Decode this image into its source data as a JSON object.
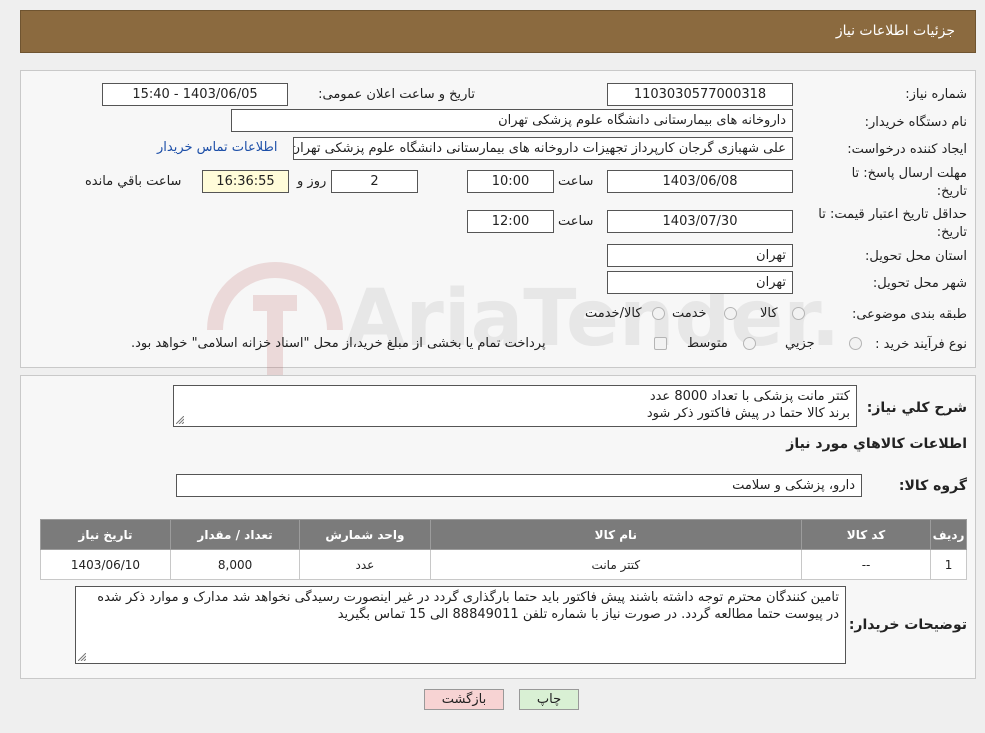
{
  "header": {
    "title": "جزئیات اطلاعات نیاز"
  },
  "form": {
    "need_number_label": "شماره نیاز:",
    "need_number": "1103030577000318",
    "announce_label": "تاریخ و ساعت اعلان عمومی:",
    "announce_value": "1403/06/05 - 15:40",
    "buyer_org_label": "نام دستگاه خریدار:",
    "buyer_org": "داروخانه های بیمارستانی دانشگاه علوم پزشکی تهران",
    "creator_label": "ایجاد کننده درخواست:",
    "creator": "علی شهبازی گرجان کارپرداز تجهیزات داروخانه های بیمارستانی دانشگاه علوم پزشکی تهران",
    "contact_link": "اطلاعات تماس خریدار",
    "reply_deadline_label_1": "مهلت ارسال پاسخ: تا",
    "reply_deadline_label_2": "تاریخ:",
    "reply_date": "1403/06/08",
    "time_label": "ساعت",
    "reply_time": "10:00",
    "days_value": "2",
    "days_label": "روز و",
    "remaining_time": "16:36:55",
    "remaining_label": "ساعت باقي مانده",
    "price_validity_label_1": "حداقل تاریخ اعتبار قیمت: تا",
    "price_validity_label_2": "تاریخ:",
    "validity_date": "1403/07/30",
    "validity_time": "12:00",
    "province_label": "استان محل تحویل:",
    "province": "تهران",
    "city_label": "شهر محل تحویل:",
    "city": "تهران",
    "category_label": "طبقه بندی موضوعی:",
    "category_options": [
      "کالا",
      "خدمت",
      "کالا/خدمت"
    ],
    "process_label": "نوع فرآیند خرید :",
    "process_options": [
      "جزیي",
      "متوسط"
    ],
    "process_note": "پرداخت تمام یا بخشی از مبلغ خرید،از محل \"اسناد خزانه اسلامی\" خواهد بود."
  },
  "details": {
    "summary_label": "شرح کلي نياز:",
    "summary_line1": "کتتر مانت پزشکی با تعداد 8000 عدد",
    "summary_line2": "برند کالا حتما در پیش فاکتور ذکر شود",
    "items_title": "اطلاعات کالاهاي مورد نياز",
    "group_label": "گروه کالا:",
    "group_value": "دارو، پزشکی و سلامت",
    "columns": [
      "ردیف",
      "کد کالا",
      "نام کالا",
      "واحد شمارش",
      "تعداد / مقدار",
      "تاریخ نیاز"
    ],
    "rows": [
      {
        "index": "1",
        "code": "--",
        "name": "کتتر مانت",
        "unit": "عدد",
        "qty": "8,000",
        "date": "1403/06/10"
      }
    ],
    "buyer_notes_label": "توضیحات خریدار:",
    "buyer_notes": "تامین کنندگان محترم توجه داشته باشند پیش فاکتور باید حتما بارگذاری گردد در غیر اینصورت رسیدگی نخواهد شد مدارک و موارد ذکر شده در پیوست حتما مطالعه گردد. در صورت نیاز با شماره تلفن 88849011 الی 15 تماس بگیرید"
  },
  "buttons": {
    "print": "چاپ",
    "back": "بازگشت"
  },
  "watermark": {
    "text": "AriaTender.neT"
  },
  "colors": {
    "header_bg": "#8b6a3f",
    "table_header_bg": "#7b7b7b",
    "link": "#1d4fa8",
    "remaining_bg": "#fffcd9",
    "back_btn_bg": "#f7d3d3",
    "print_btn_bg": "#d9f0d4"
  }
}
